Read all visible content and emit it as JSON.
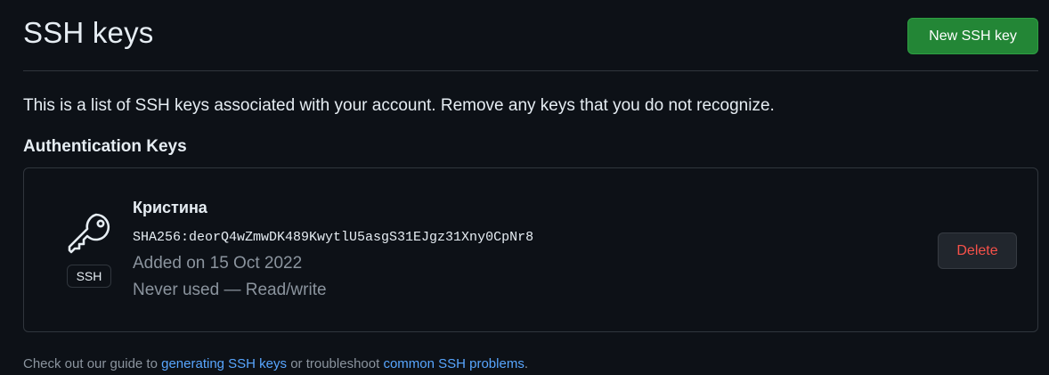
{
  "header": {
    "title": "SSH keys",
    "new_key_label": "New SSH key"
  },
  "intro": "This is a list of SSH keys associated with your account. Remove any keys that you do not recognize.",
  "auth_section": {
    "title": "Authentication Keys",
    "keys": [
      {
        "title": "Кристина",
        "fingerprint": "SHA256:deorQ4wZmwDK489KwytlU5asgS31EJgz31Xny0CpNr8",
        "added": "Added on 15 Oct 2022",
        "usage": "Never used — Read/write",
        "type_badge": "SSH",
        "icon": "key-icon",
        "delete_label": "Delete"
      }
    ]
  },
  "footer": {
    "prefix": "Check out our guide to ",
    "link1": "generating SSH keys",
    "middle": " or troubleshoot ",
    "link2": "common SSH problems",
    "suffix": "."
  },
  "colors": {
    "background": "#0d1117",
    "primary_button": "#238636",
    "danger_text": "#f85149",
    "link": "#58a6ff",
    "muted_text": "#8b949e",
    "border": "#30363d"
  }
}
